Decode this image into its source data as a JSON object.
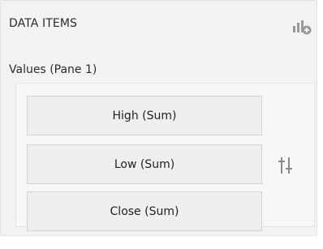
{
  "header": {
    "title": "DATA ITEMS",
    "add_icon": "add-data-item-icon"
  },
  "pane": {
    "label": "Values (Pane 1)",
    "items": [
      {
        "label": "High (Sum)"
      },
      {
        "label": "Low (Sum)"
      },
      {
        "label": "Close (Sum)"
      }
    ],
    "options_icon": "series-options-icon"
  },
  "colors": {
    "panel_bg": "#f3f3f3",
    "item_bg": "#efefef",
    "item_border": "#d3d3d3",
    "icon_gray": "#8a8a8a"
  }
}
